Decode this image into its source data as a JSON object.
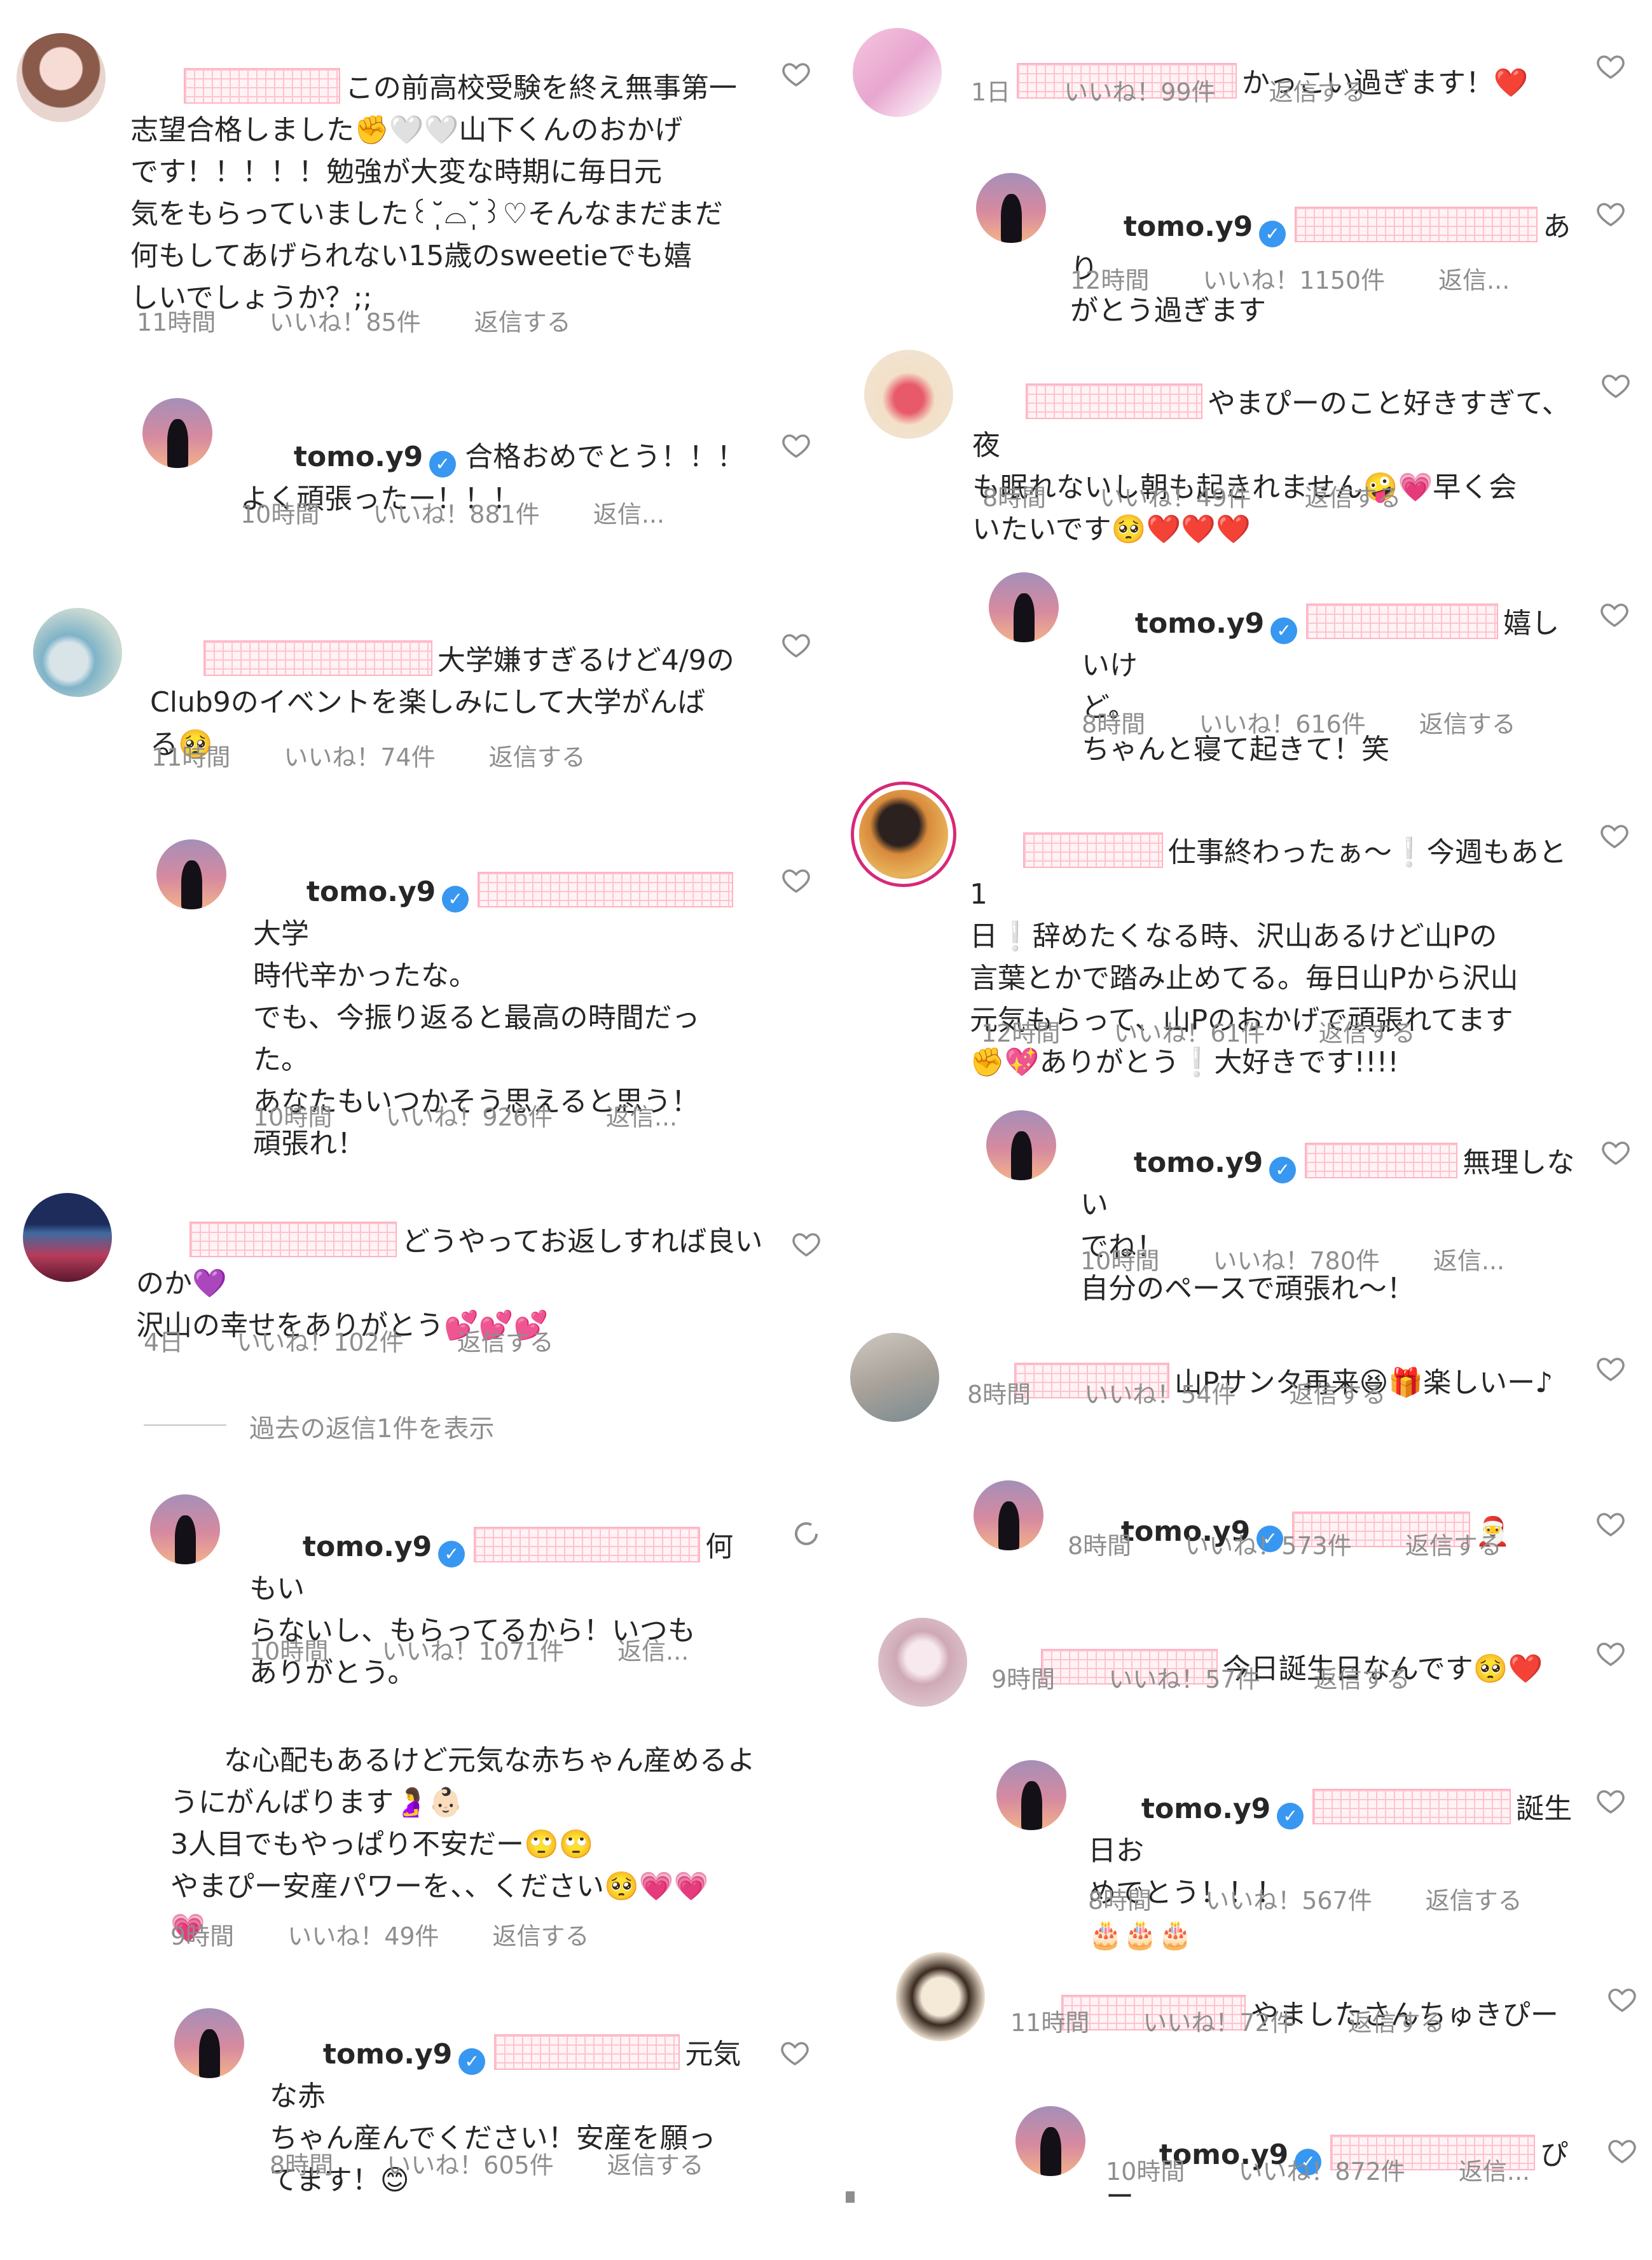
{
  "left_column": [
    {
      "avatar": "doll-avatar",
      "text": "この前高校受験を終え無事第一\n志望合格しました✊🤍🤍山下くんのおかげ\nです！！！！！勉強が大変な時期に毎日元\n気をもらっていました꒰˘̩̩̩⌓˘̩̩̩꒱♡そんなまだまだ\n何もしてあげられない15歳のsweetieでも嬉\nしいでしょうか？;;",
      "time": "11時間",
      "likes": "いいね！85件",
      "reply": "返信する"
    },
    {
      "avatar": "tomo-avatar",
      "username": "tomo.y9",
      "text": "合格おめでとう！！！\nよく頑張ったー！！！",
      "time": "10時間",
      "likes": "いいね！881件",
      "reply": "返信..."
    },
    {
      "avatar": "sea-avatar",
      "text": "大学嫌すぎるけど4/9の\nClub9のイベントを楽しみにして大学がんば\nる🥺",
      "time": "11時間",
      "likes": "いいね！74件",
      "reply": "返信する"
    },
    {
      "avatar": "tomo-avatar",
      "username": "tomo.y9",
      "text": "大学\n時代辛かったな。\nでも、今振り返ると最高の時間だっ\nた。\nあなたもいつかそう思えると思う！\n頑張れ！",
      "time": "10時間",
      "likes": "いいね！926件",
      "reply": "返信..."
    },
    {
      "avatar": "palm-avatar",
      "text": "どうやってお返しすれば良い\nのか💜\n沢山の幸せをありがとう💕💕💕",
      "time": "4日",
      "likes": "いいね！102件",
      "reply": "返信する"
    },
    {
      "view_replies": "過去の返信1件を表示"
    },
    {
      "avatar": "tomo-avatar",
      "username": "tomo.y9",
      "text": "何もい\nらないし、もらってるから！いつも\nありがとう。",
      "time": "10時間",
      "likes": "いいね！1071件",
      "reply": "返信..."
    },
    {
      "text": "な心配もあるけど元気な赤ちゃん産めるよ\nうにがんばります🤰👶🏻\n3人目でもやっぱり不安だー🙄🙄\nやまぴー安産パワーを、、ください🥺💗💗\n💗",
      "time": "9時間",
      "likes": "いいね！49件",
      "reply": "返信する"
    },
    {
      "avatar": "tomo-avatar",
      "username": "tomo.y9",
      "text": "元気な赤\nちゃん産んでください！安産を願っ\nてます！😊",
      "time": "8時間",
      "likes": "いいね！605件",
      "reply": "返信する"
    }
  ],
  "right_column": [
    {
      "avatar": "pink-avatar",
      "text": "かっこい過ぎます！❤️",
      "time": "1日",
      "likes": "いいね！99件",
      "reply": "返信する"
    },
    {
      "avatar": "tomo-avatar",
      "username": "tomo.y9",
      "text": "あり\nがとう過ぎます",
      "time": "12時間",
      "likes": "いいね！1150件",
      "reply": "返信..."
    },
    {
      "avatar": "shoes-avatar",
      "text": "やまぴーのこと好きすぎて、夜\nも眠れないし朝も起きれません🤪💗早く会\nいたいです🥺❤️❤️❤️",
      "time": "8時間",
      "likes": "いいね！49件",
      "reply": "返信する"
    },
    {
      "avatar": "tomo-avatar",
      "username": "tomo.y9",
      "text": "嬉しいけ\nど。\nちゃんと寝て起きて！笑",
      "time": "8時間",
      "likes": "いいね！616件",
      "reply": "返信する"
    },
    {
      "avatar": "sunset-avatar",
      "text": "仕事終わったぁ〜❕今週もあと1\n日❕辞めたくなる時、沢山あるけど山Pの\n言葉とかで踏み止めてる。毎日山Pから沢山\n元気もらって、山Pのおかげで頑張れてます\n✊💖ありがとう❕大好きです!!!!",
      "time": "12時間",
      "likes": "いいね！61件",
      "reply": "返信する"
    },
    {
      "avatar": "tomo-avatar",
      "username": "tomo.y9",
      "text": "無理しない\nでね！\n自分のペースで頑張れ〜！",
      "time": "10時間",
      "likes": "いいね！780件",
      "reply": "返信..."
    },
    {
      "avatar": "room-avatar",
      "text": "山Pサンタ再来😆🎁楽しいー♪",
      "time": "8時間",
      "likes": "いいね！54件",
      "reply": "返信する"
    },
    {
      "avatar": "tomo-avatar",
      "username": "tomo.y9",
      "text": "🎅",
      "time": "8時間",
      "likes": "いいね！573件",
      "reply": "返信する"
    },
    {
      "avatar": "girl-avatar",
      "text": "今日誕生日なんです🥺❤️",
      "time": "9時間",
      "likes": "いいね！57件",
      "reply": "返信する"
    },
    {
      "avatar": "tomo-avatar",
      "username": "tomo.y9",
      "text": "誕生日お\nめでとう！！！\n🎂🎂🎂",
      "time": "8時間",
      "likes": "いいね！567件",
      "reply": "返信する"
    },
    {
      "avatar": "bear-avatar",
      "text": "やましたさんちゅきぴー",
      "time": "11時間",
      "likes": "いいね！72件",
      "reply": "返信する"
    },
    {
      "avatar": "tomo-avatar",
      "username": "tomo.y9",
      "text": "ぴー",
      "time": "10時間",
      "likes": "いいね！872件",
      "reply": "返信..."
    }
  ],
  "colors": {
    "text": "#262626",
    "meta": "#8e8e8e",
    "verified": "#3897f0",
    "mention_redaction": "#ffc3cf"
  }
}
